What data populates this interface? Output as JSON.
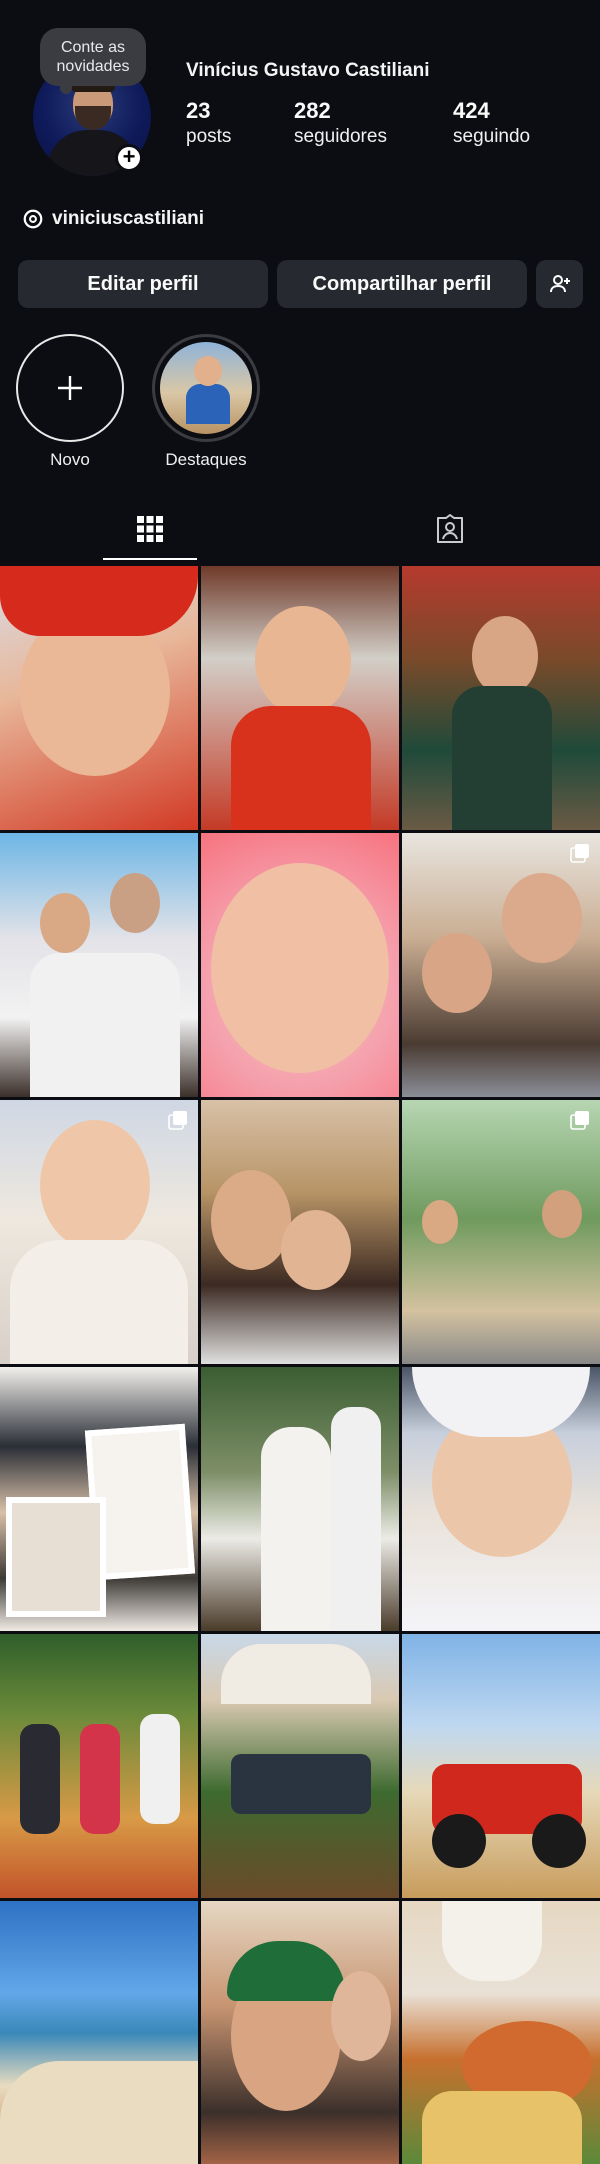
{
  "profile": {
    "note": "Conte as novidades",
    "display_name": "Vinícius Gustavo Castiliani",
    "stats": [
      {
        "value": "23",
        "label": "posts"
      },
      {
        "value": "282",
        "label": "seguidores"
      },
      {
        "value": "424",
        "label": "seguindo"
      }
    ],
    "threads_handle": "viniciuscastiliani"
  },
  "actions": {
    "edit_label": "Editar perfil",
    "share_label": "Compartilhar perfil",
    "add_user_icon": "add-person-icon"
  },
  "highlights": [
    {
      "label": "Novo",
      "icon": "plus-icon"
    },
    {
      "label": "Destaques"
    }
  ],
  "tabs": [
    {
      "name": "posts-grid",
      "icon": "grid-icon",
      "active": true
    },
    {
      "name": "tagged",
      "icon": "tagged-person-icon",
      "active": false
    }
  ],
  "posts": [
    {
      "subject": "child-santa-hat",
      "multiple": false
    },
    {
      "subject": "child-santa-hat-christmas-tree",
      "multiple": false
    },
    {
      "subject": "child-festa-junina",
      "multiple": false
    },
    {
      "subject": "family-birthday-party",
      "multiple": false
    },
    {
      "subject": "child-closeup-pink",
      "multiple": false
    },
    {
      "subject": "family-selfie",
      "multiple": true
    },
    {
      "subject": "newborn-baby",
      "multiple": true
    },
    {
      "subject": "mother-child-giraffe",
      "multiple": false
    },
    {
      "subject": "family-outdoor-park",
      "multiple": true
    },
    {
      "subject": "collage-polaroids",
      "multiple": false
    },
    {
      "subject": "maternity-photo",
      "multiple": false
    },
    {
      "subject": "sleeping-newborn",
      "multiple": false
    },
    {
      "subject": "cyclists-group",
      "multiple": false
    },
    {
      "subject": "cyclists-church-gate",
      "multiple": false
    },
    {
      "subject": "quad-bike-beach",
      "multiple": false
    },
    {
      "subject": "beach-coastline",
      "multiple": false
    },
    {
      "subject": "couple-selfie-cap",
      "multiple": false
    },
    {
      "subject": "beer-and-food",
      "multiple": false
    }
  ],
  "colors": {
    "background": "#0b0d12",
    "button": "#26292f",
    "text": "#ffffff"
  }
}
